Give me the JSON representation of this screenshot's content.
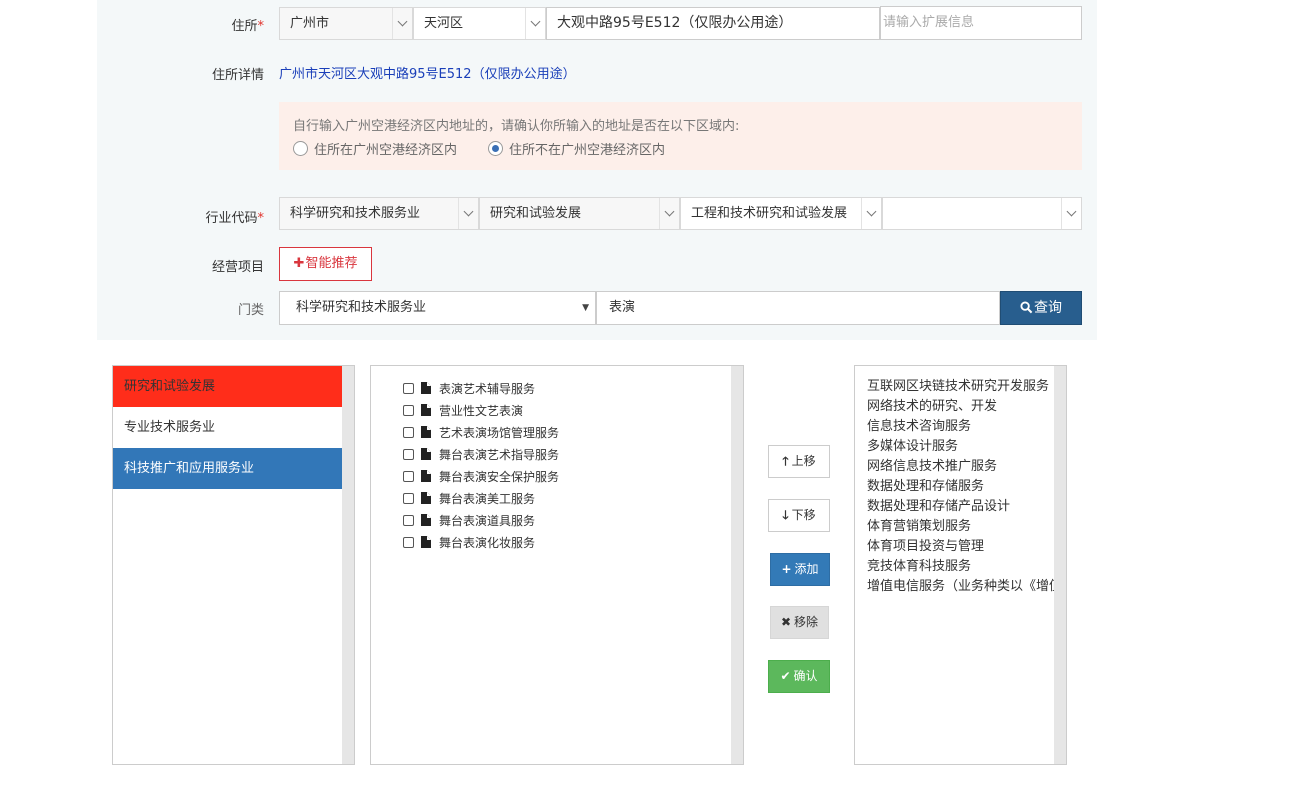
{
  "address": {
    "label": "住所",
    "required_mark": "*",
    "city": "广州市",
    "district": "天河区",
    "street": "大观中路95号E512（仅限办公用途）",
    "extra_placeholder": "请输入扩展信息"
  },
  "address_detail": {
    "label": "住所详情",
    "value": "广州市天河区大观中路95号E512（仅限办公用途）"
  },
  "notice": {
    "message": "自行输入广州空港经济区内地址的，请确认你所输入的地址是否在以下区域内:",
    "option_in": "住所在广州空港经济区内",
    "option_out": "住所不在广州空港经济区内",
    "selected": "option_out"
  },
  "industry": {
    "label": "行业代码",
    "required_mark": "*",
    "level1": "科学研究和技术服务业",
    "level2": "研究和试验发展",
    "level3": "工程和技术研究和试验发展",
    "level4": ""
  },
  "business": {
    "label": "经营项目",
    "smart_button": "智能推荐"
  },
  "category": {
    "label": "门类",
    "select_value": "科学研究和技术服务业",
    "keyword": "表演",
    "query_button": "查询"
  },
  "left_list": [
    {
      "label": "研究和试验发展",
      "state": "active-red"
    },
    {
      "label": "专业技术服务业",
      "state": "normal"
    },
    {
      "label": "科技推广和应用服务业",
      "state": "selected"
    }
  ],
  "tree_items": [
    "表演艺术辅导服务",
    "营业性文艺表演",
    "艺术表演场馆管理服务",
    "舞台表演艺术指导服务",
    "舞台表演安全保护服务",
    "舞台表演美工服务",
    "舞台表演道具服务",
    "舞台表演化妆服务"
  ],
  "actions": {
    "up": "上移",
    "down": "下移",
    "add": "添加",
    "remove": "移除",
    "confirm": "确认"
  },
  "selected_items": [
    "互联网区块链技术研究开发服务",
    "网络技术的研究、开发",
    "信息技术咨询服务",
    "多媒体设计服务",
    "网络信息技术推广服务",
    "数据处理和存储服务",
    "数据处理和存储产品设计",
    "体育营销策划服务",
    "体育项目投资与管理",
    "竞技体育科技服务",
    "增值电信服务（业务种类以《增值电信业务经营许可证》载明内容为准）"
  ],
  "colors": {
    "form_bg": "#f4f8f9",
    "notice_bg": "#fdefea",
    "link_blue": "#1a3fb9",
    "active_red": "#ff2d1a",
    "selected_blue": "#3277b8",
    "primary": "#337ab7",
    "query_dark": "#285e8e",
    "success": "#5cb85c"
  }
}
